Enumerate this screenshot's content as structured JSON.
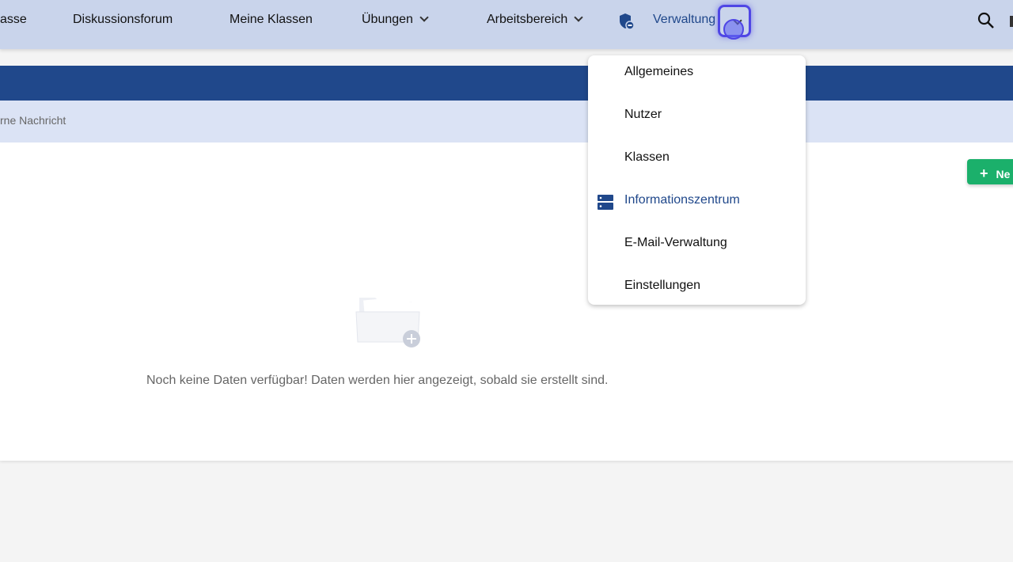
{
  "nav": {
    "items": [
      {
        "label": "asse"
      },
      {
        "label": "Diskussionsforum"
      },
      {
        "label": "Meine Klassen"
      },
      {
        "label": "Übungen"
      },
      {
        "label": "Arbeitsbereich"
      },
      {
        "label": "Verwaltung"
      }
    ]
  },
  "subheader": {
    "text": "rne Nachricht"
  },
  "new_button": {
    "label": "Ne"
  },
  "empty_state": {
    "text": "Noch keine Daten verfügbar! Daten werden hier angezeigt, sobald sie erstellt sind."
  },
  "dropdown": {
    "items": [
      {
        "label": "Allgemeines"
      },
      {
        "label": "Nutzer"
      },
      {
        "label": "Klassen"
      },
      {
        "label": "Informationszentrum"
      },
      {
        "label": "E-Mail-Verwaltung"
      },
      {
        "label": "Einstellungen"
      }
    ]
  },
  "colors": {
    "nav": "#c9d4eb",
    "band": "#20488b",
    "accent": "#1bb06b"
  }
}
